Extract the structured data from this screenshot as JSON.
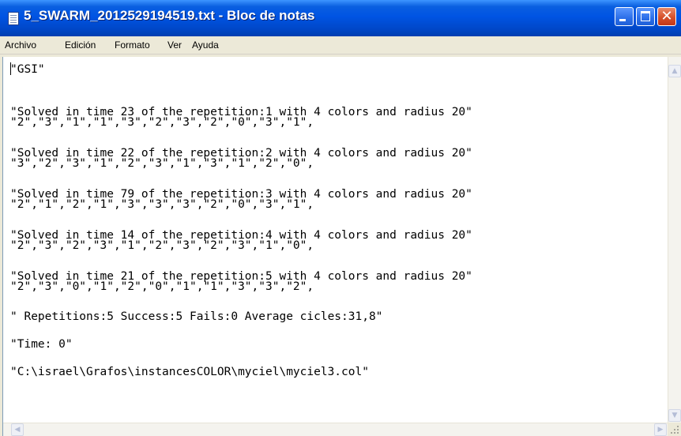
{
  "window": {
    "title": "5_SWARM_2012529194519.txt - Bloc de notas",
    "controls": {
      "minimize_icon": "minimize-icon",
      "maximize_icon": "maximize-icon",
      "close_icon": "close-icon"
    }
  },
  "menu": {
    "items": [
      "Archivo",
      "Edición",
      "Formato",
      "Ver",
      "Ayuda"
    ]
  },
  "document": {
    "lines": [
      "\"GSI\"",
      "\"Solved in time 23 of the repetition:1 with 4 colors and radius 20\"",
      "\"2\",\"3\",\"1\",\"1\",\"3\",\"2\",\"3\",\"2\",\"0\",\"3\",\"1\",",
      "\"Solved in time 22 of the repetition:2 with 4 colors and radius 20\"",
      "\"3\",\"2\",\"3\",\"1\",\"2\",\"3\",\"1\",\"3\",\"1\",\"2\",\"0\",",
      "\"Solved in time 79 of the repetition:3 with 4 colors and radius 20\"",
      "\"2\",\"1\",\"2\",\"1\",\"3\",\"3\",\"3\",\"2\",\"0\",\"3\",\"1\",",
      "\"Solved in time 14 of the repetition:4 with 4 colors and radius 20\"",
      "\"2\",\"3\",\"2\",\"3\",\"1\",\"2\",\"3\",\"2\",\"3\",\"1\",\"0\",",
      "\"Solved in time 21 of the repetition:5 with 4 colors and radius 20\"",
      "\"2\",\"3\",\"0\",\"1\",\"2\",\"0\",\"1\",\"1\",\"3\",\"3\",\"2\",",
      "\" Repetitions:5 Success:5 Fails:0 Average cicles:31,8\"",
      "\"Time: 0\"",
      "\"C:\\israel\\Grafos\\instancesCOLOR\\myciel\\myciel3.col\""
    ]
  },
  "colors": {
    "titlebar": "#0054e3",
    "close_button": "#d6502a",
    "menubar": "#ece9d8",
    "editor_background": "#ffffff"
  }
}
